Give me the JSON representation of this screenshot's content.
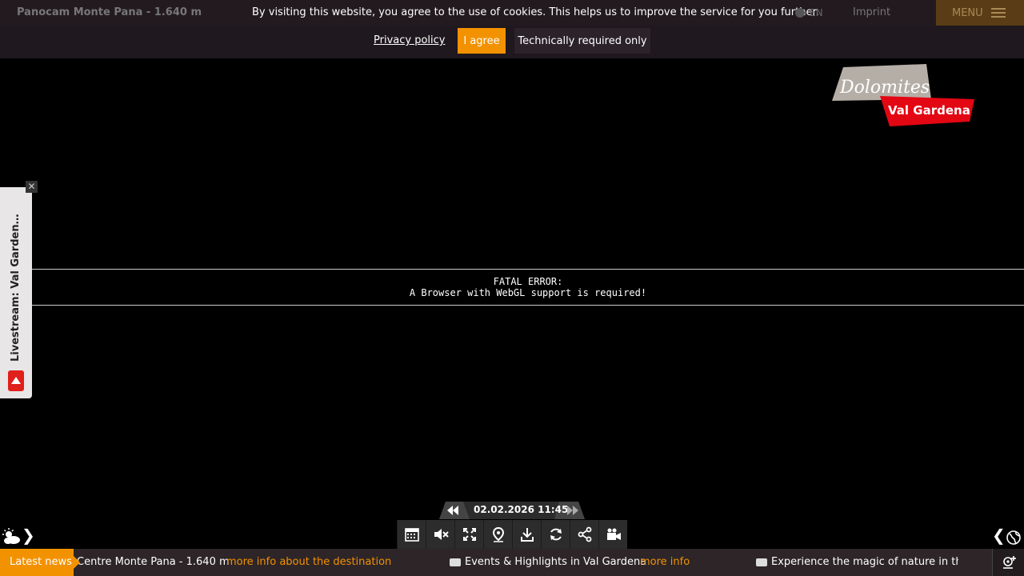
{
  "header": {
    "title": "Panocam Monte Pana - 1.640 m",
    "cookie_text": "By visiting this website, you agree to the use of cookies. This helps us to improve the service for you further.",
    "language": "EN",
    "imprint": "Imprint",
    "menu": "MENU"
  },
  "cookie": {
    "privacy_label": "Privacy policy",
    "agree_label": "I agree",
    "technical_label": "Technically required only"
  },
  "logo": {
    "line1": "Dolomites",
    "line2": "Val Gardena"
  },
  "error": {
    "line1": "FATAL ERROR:",
    "line2": "A Browser with WebGL support is required!"
  },
  "side_tab": {
    "label": "Livestream: Val Gardena..."
  },
  "datebar": {
    "date": "02.02.2026",
    "time": "11:45"
  },
  "news": {
    "badge": "Latest news",
    "items": [
      {
        "text": "Centre Monte Pana - 1.640 m",
        "link": "more info about the destination"
      },
      {
        "text": "Events & Highlights in Val Gardena",
        "link": "more info"
      },
      {
        "text": "Experience the magic of nature in the D"
      }
    ]
  },
  "colors": {
    "accent": "#f39200",
    "logo_grey": "#b5aea6",
    "logo_red": "#e30613"
  }
}
